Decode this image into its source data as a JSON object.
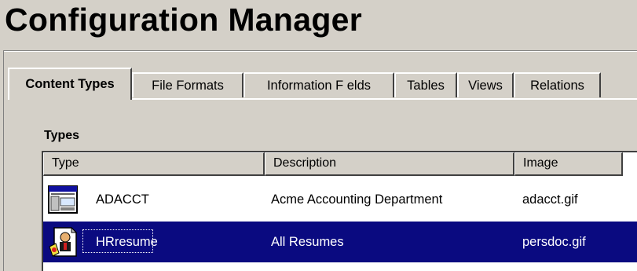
{
  "window": {
    "title": "Configuration Manager"
  },
  "tabs": [
    {
      "label": "Content Types",
      "active": true
    },
    {
      "label": "File Formats",
      "active": false
    },
    {
      "label": "Information F elds",
      "active": false
    },
    {
      "label": "Tables",
      "active": false
    },
    {
      "label": "Views",
      "active": false
    },
    {
      "label": "Relations",
      "active": false
    }
  ],
  "types": {
    "label": "Types",
    "columns": [
      "Type",
      "Description",
      "Image"
    ],
    "rows": [
      {
        "type": "ADACCT",
        "description": "Acme Accounting Department",
        "image": "adacct.gif",
        "icon": "window-document-icon",
        "selected": false
      },
      {
        "type": "HRresume",
        "description": "All Resumes",
        "image": "persdoc.gif",
        "icon": "person-document-icon",
        "selected": true
      }
    ]
  },
  "colors": {
    "selection": "#0a0a80",
    "face": "#d4d0c8"
  }
}
